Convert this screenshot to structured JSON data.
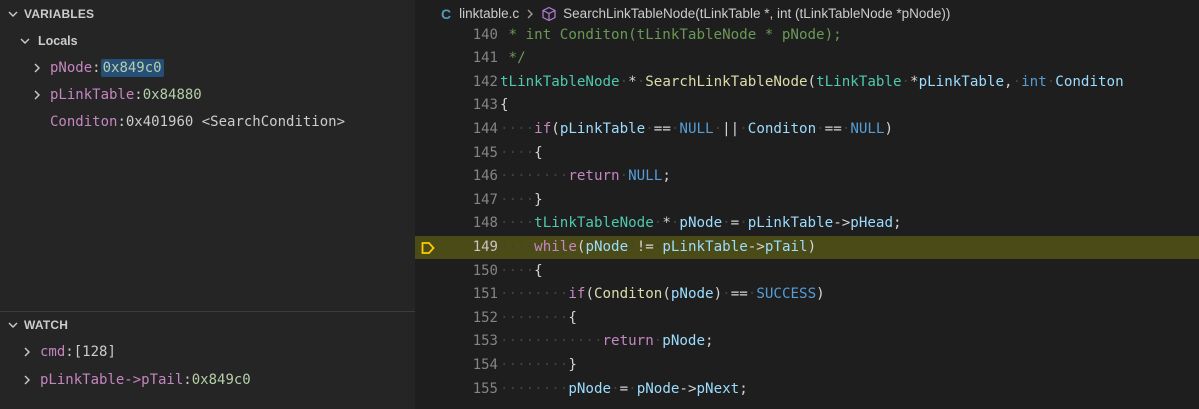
{
  "variables": {
    "header": "VARIABLES",
    "scope": "Locals",
    "items": [
      {
        "name": "pNode",
        "sep": ": ",
        "value": "0x849c0"
      },
      {
        "name": "pLinkTable",
        "sep": ": ",
        "value": "0x84880"
      },
      {
        "name": "Conditon",
        "sep": ": ",
        "value": "0x401960 <SearchCondition>"
      }
    ]
  },
  "watch": {
    "header": "WATCH",
    "items": [
      {
        "name": "cmd",
        "sep": ": ",
        "value": "[128]"
      },
      {
        "name": "pLinkTable->pTail",
        "sep": ": ",
        "value": "0x849c0"
      }
    ]
  },
  "breadcrumb": {
    "file": "linktable.c",
    "symbol": "SearchLinkTableNode(tLinkTable *, int (tLinkTableNode *pNode))"
  },
  "editor": {
    "current_line": 149,
    "lines": [
      {
        "num": "140",
        "text": " * int Conditon(tLinkTableNode * pNode);"
      },
      {
        "num": "141",
        "text": " */"
      },
      {
        "num": "142",
        "text": "tLinkTableNode * SearchLinkTableNode(tLinkTable *pLinkTable, int Conditon"
      },
      {
        "num": "143",
        "text": "{"
      },
      {
        "num": "144",
        "text": "    if(pLinkTable == NULL || Conditon == NULL)"
      },
      {
        "num": "145",
        "text": "    {"
      },
      {
        "num": "146",
        "text": "        return NULL;"
      },
      {
        "num": "147",
        "text": "    }"
      },
      {
        "num": "148",
        "text": "    tLinkTableNode * pNode = pLinkTable->pHead;"
      },
      {
        "num": "149",
        "text": "    while(pNode != pLinkTable->pTail)"
      },
      {
        "num": "150",
        "text": "    {"
      },
      {
        "num": "151",
        "text": "        if(Conditon(pNode) == SUCCESS)"
      },
      {
        "num": "152",
        "text": "        {"
      },
      {
        "num": "153",
        "text": "            return pNode;"
      },
      {
        "num": "154",
        "text": "        }"
      },
      {
        "num": "155",
        "text": "        pNode = pNode->pNext;"
      }
    ]
  },
  "colors": {
    "current_line_bg": "#4b4b18",
    "breakpoint_arrow": "#ffcc00",
    "panel_bg": "#252526",
    "editor_bg": "#1e1e1e"
  }
}
